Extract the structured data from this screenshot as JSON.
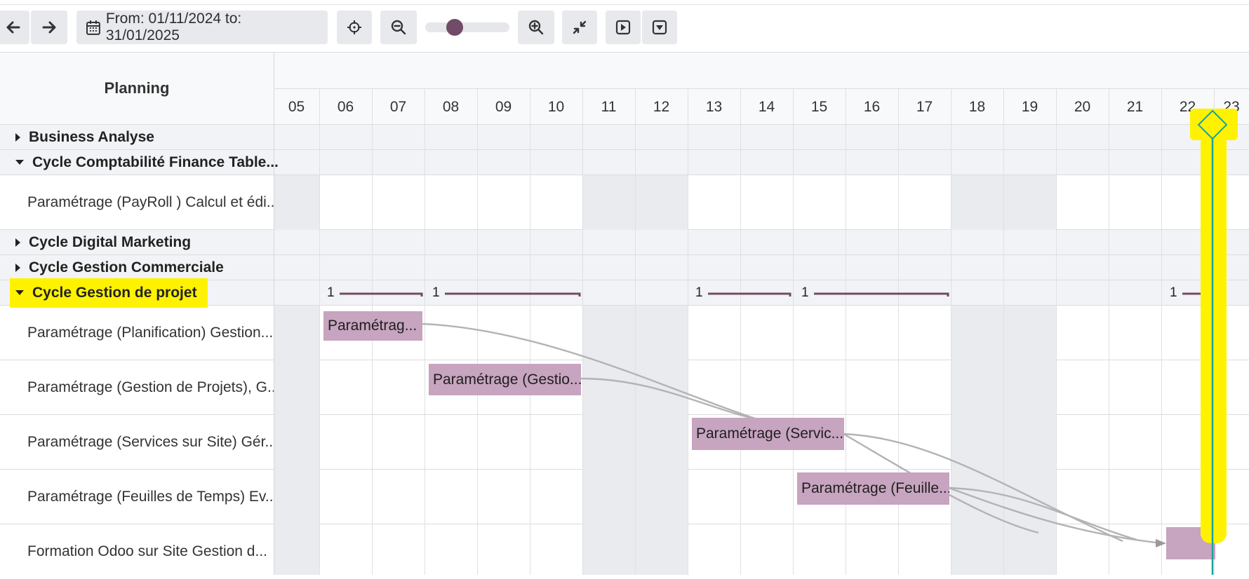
{
  "toolbar": {
    "date_range_label": "From: 01/11/2024 to: 31/01/2025"
  },
  "planning": {
    "header_title": "Planning",
    "days": [
      "05",
      "06",
      "07",
      "08",
      "09",
      "10",
      "11",
      "12",
      "13",
      "14",
      "15",
      "16",
      "17",
      "18",
      "19",
      "20",
      "21",
      "22",
      "23"
    ]
  },
  "rows": {
    "business_analyse": "Business Analyse",
    "cycle_compta": "Cycle Comptabilité Finance Table...",
    "payroll": "Paramétrage (PayRoll ) Calcul et édi...",
    "digital_marketing": "Cycle Digital Marketing",
    "gestion_commerciale": "Cycle Gestion Commerciale",
    "gestion_projet": "Cycle Gestion de projet",
    "planification": "Paramétrage (Planification) Gestion...",
    "gestion_projets": "Paramétrage (Gestion de Projets), G...",
    "services_site": "Paramétrage (Services sur Site) Gér...",
    "feuilles_temps": "Paramétrage (Feuilles de Temps) Ev...",
    "formation": "Formation Odoo sur Site Gestion d..."
  },
  "bars": {
    "bar1": "Paramétrag...",
    "bar2": "Paramétrage (Gestio...",
    "bar3": "Paramétrage (Servic...",
    "bar4": "Paramétrage (Feuille...",
    "bar5": ""
  },
  "counts": [
    "1",
    "1",
    "1",
    "1",
    "1"
  ],
  "colors": {
    "accent": "#714b67",
    "bar": "#c7a4bf",
    "highlight": "#fff200",
    "today_line": "#1aa39a"
  }
}
